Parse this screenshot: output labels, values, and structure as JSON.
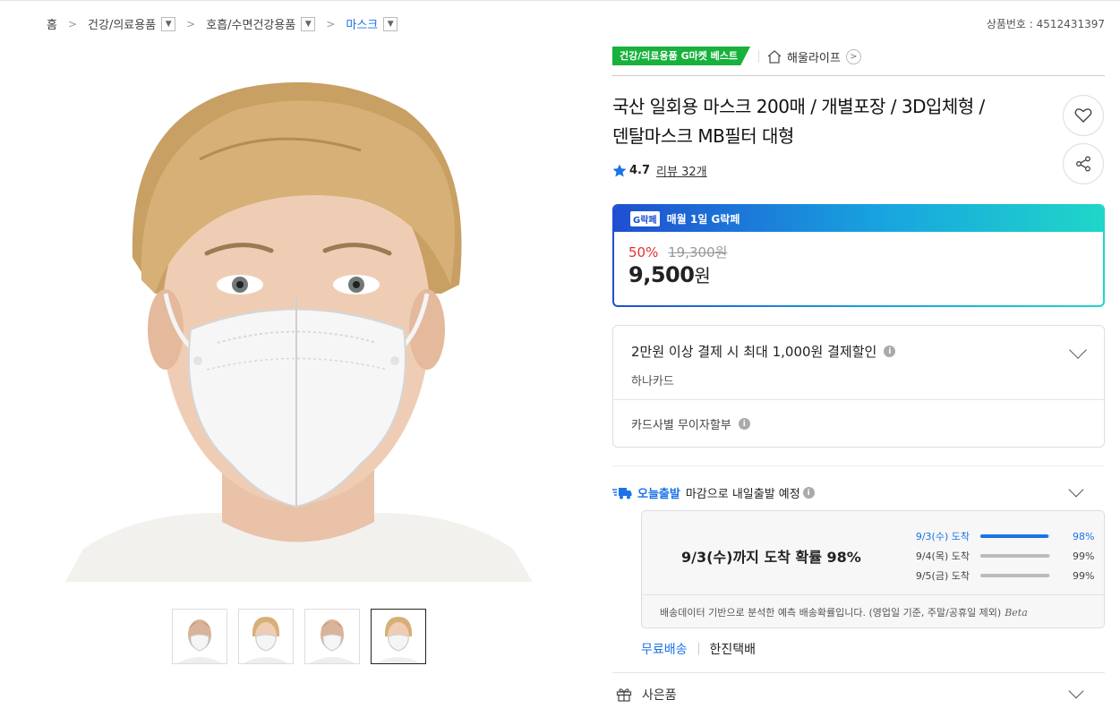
{
  "breadcrumb": {
    "home": "홈",
    "items": [
      "건강/의료용품",
      "호흡/수면건강용품",
      "마스크"
    ]
  },
  "product_no": "상품번호 : 4512431397",
  "badges": {
    "best": "건강/의료용품 G마켓 베스트",
    "store": "해울라이프"
  },
  "product": {
    "title_line1": "국산 일회용 마스크 200매 / 개별포장 / 3D입체형 /",
    "title_line2": "덴탈마스크 MB필터 대형",
    "rating": "4.7",
    "reviews": "리뷰 32개"
  },
  "price": {
    "event_badge": "G락페",
    "event_label": "매월 1일 G락페",
    "discount": "50%",
    "original": "19,300원",
    "final": "9,500",
    "won": "원"
  },
  "card_benefit": {
    "main": "2만원 이상 결제 시 최대 1,000원 결제할인",
    "sub": "하나카드",
    "installment": "카드사별 무이자할부"
  },
  "delivery": {
    "brand": "오늘출발",
    "desc": "마감으로 내일출발 예정",
    "prob_main": "9/3(수)까지 도착 확률 98%",
    "rows": [
      {
        "date": "9/3(수) 도착",
        "pct_label": "98%",
        "pct": 0.98
      },
      {
        "date": "9/4(목) 도착",
        "pct_label": "99%",
        "pct": 0.99
      },
      {
        "date": "9/5(금) 도착",
        "pct_label": "99%",
        "pct": 0.99
      }
    ],
    "note": "배송데이터 기반으로 분석한 예측 배송확률입니다. (영업일 기준, 주말/공휴일 제외)",
    "beta": "Beta",
    "free_ship": "무료배송",
    "carrier": "한진택배"
  },
  "gift": {
    "label": "사은품"
  },
  "colors": {
    "accent_blue": "#1a73e8",
    "best_green": "#17b13b",
    "discount_red": "#e52f2f"
  }
}
